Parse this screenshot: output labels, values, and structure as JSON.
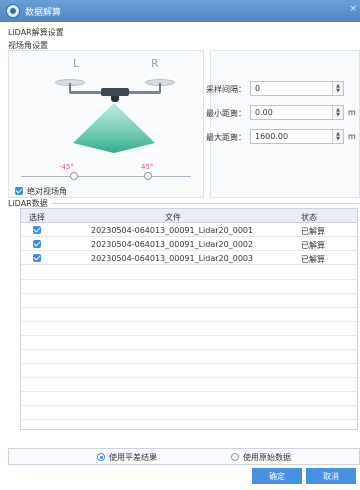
{
  "window": {
    "title": "数据解算"
  },
  "section": {
    "lidar_settings": "LiDAR解算设置",
    "view_angle": "视场角设置",
    "lidar_data": "LiDAR数据"
  },
  "view": {
    "left_label": "L",
    "right_label": "R",
    "left_angle": "-45°",
    "right_angle": "45°",
    "absolute_label": "绝对视场角",
    "absolute_checked": true
  },
  "params": {
    "sample_label": "采样间隔：",
    "sample_value": "0",
    "min_label": "最小距离：",
    "min_value": "0.00",
    "min_unit": "m",
    "max_label": "最大距离：",
    "max_value": "1600.00",
    "max_unit": "m"
  },
  "table": {
    "headers": [
      "选择",
      "文件",
      "状态"
    ],
    "rows": [
      {
        "checked": true,
        "file": "20230504-064013_00091_Lidar20_0001",
        "status": "已解算"
      },
      {
        "checked": true,
        "file": "20230504-064013_00091_Lidar20_0002",
        "status": "已解算"
      },
      {
        "checked": true,
        "file": "20230504-064013_00091_Lidar20_0003",
        "status": "已解算"
      }
    ]
  },
  "options": {
    "use_adjusted": "使用平差结果",
    "use_raw": "使用原始数据",
    "selected": "use_adjusted"
  },
  "buttons": {
    "ok": "确定",
    "cancel": "取消"
  },
  "colors": {
    "accent": "#4a90e2",
    "titlebar": "#5b8fcf",
    "beam": "#3fbf9f",
    "angle": "#e05a7a"
  }
}
